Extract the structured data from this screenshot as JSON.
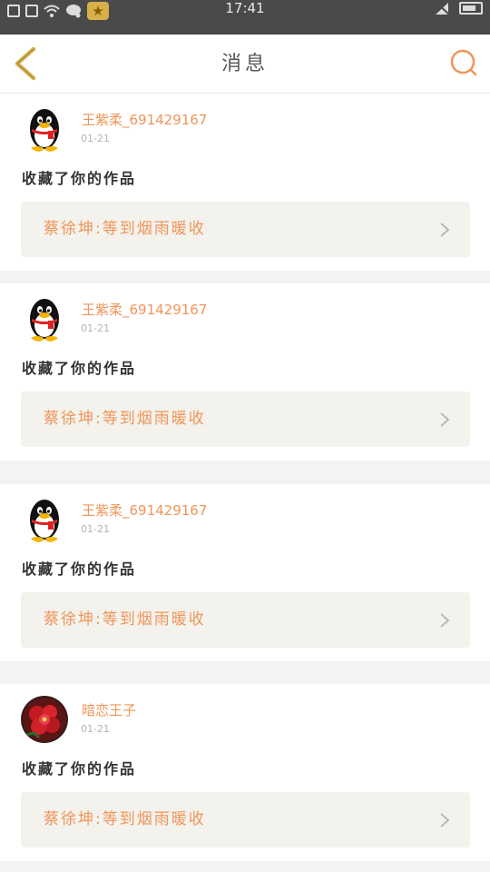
{
  "status_bar": {
    "time": "17:41",
    "icons": [
      "sim-icon",
      "sim-icon",
      "wifi-icon",
      "message-icon",
      "star-app-icon",
      "no-signal-icon",
      "battery-icon"
    ]
  },
  "header": {
    "title": "消息",
    "back_icon": "chevron-left-icon",
    "search_icon": "search-icon",
    "accent_color": "#f0955a",
    "back_color": "#d8b04a"
  },
  "messages": [
    {
      "username": "王紫柔_691429167",
      "date": "01-21",
      "action": "收藏了你的作品",
      "work_title": "蔡徐坤:等到烟雨暖收",
      "avatar": "penguin-avatar"
    },
    {
      "username": "王紫柔_691429167",
      "date": "01-21",
      "action": "收藏了你的作品",
      "work_title": "蔡徐坤:等到烟雨暖收",
      "avatar": "penguin-avatar"
    },
    {
      "username": "王紫柔_691429167",
      "date": "01-21",
      "action": "收藏了你的作品",
      "work_title": "蔡徐坤:等到烟雨暖收",
      "avatar": "penguin-avatar"
    },
    {
      "username": "暗恋王子",
      "date": "01-21",
      "action": "收藏了你的作品",
      "work_title": "蔡徐坤:等到烟雨暖收",
      "avatar": "flower-avatar"
    }
  ]
}
